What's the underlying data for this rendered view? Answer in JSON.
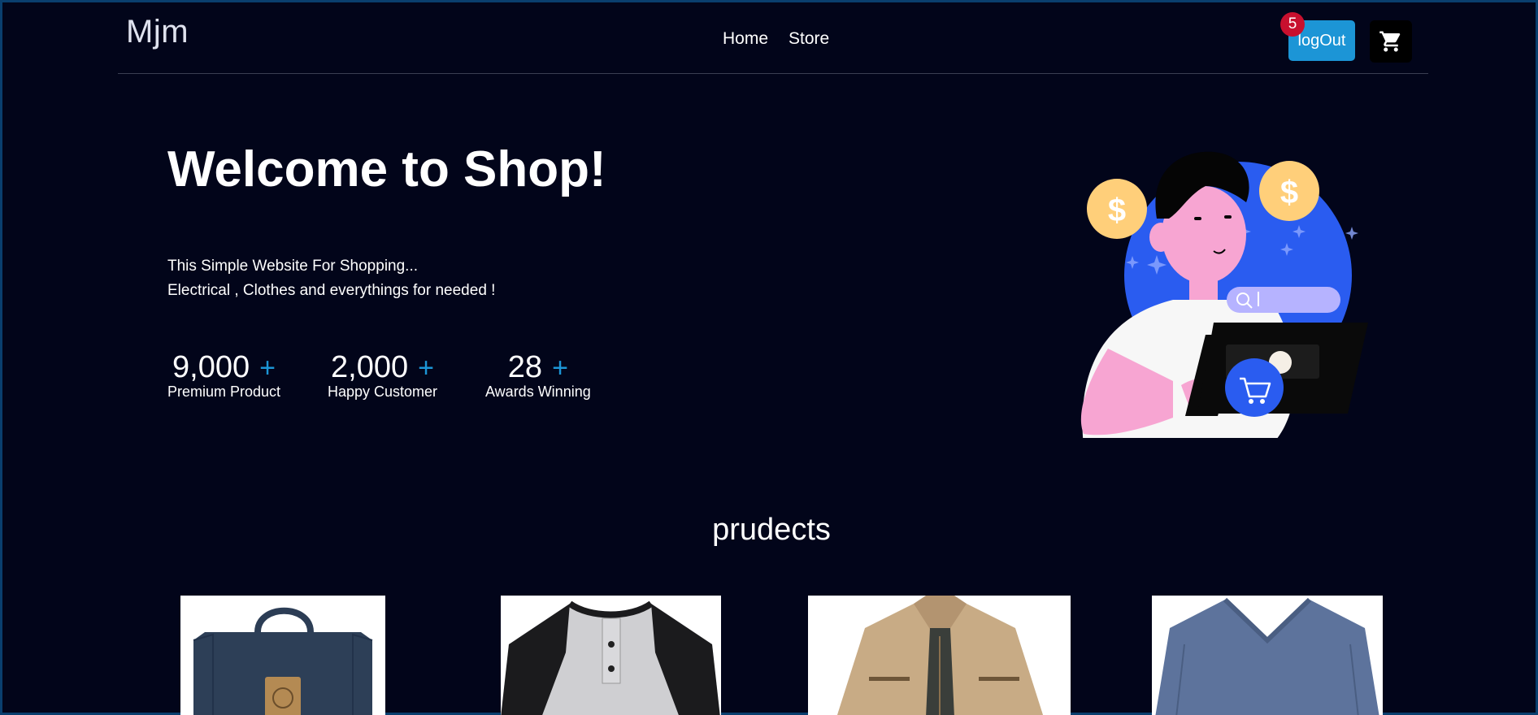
{
  "navbar": {
    "brand": "Mjm",
    "links": [
      "Home",
      "Store"
    ],
    "logout_label": "logOut",
    "cart_count": "5"
  },
  "hero": {
    "title": "Welcome to Shop!",
    "desc_line1": "This Simple Website For Shopping...",
    "desc_line2": "Electrical , Clothes and everythings for needed !",
    "stats": [
      {
        "value": "9,000",
        "plus": "+",
        "label": "Premium Product"
      },
      {
        "value": "2,000",
        "plus": "+",
        "label": "Happy Customer"
      },
      {
        "value": "28",
        "plus": "+",
        "label": "Awards Winning"
      }
    ]
  },
  "products_section": {
    "title": "prudects",
    "products": [
      {
        "image": "bag"
      },
      {
        "image": "raglan-shirt"
      },
      {
        "image": "jacket"
      },
      {
        "image": "v-neck-shirt"
      }
    ]
  },
  "colors": {
    "background": "#02051a",
    "accent": "#1c95d6",
    "badge": "#c8102e"
  }
}
